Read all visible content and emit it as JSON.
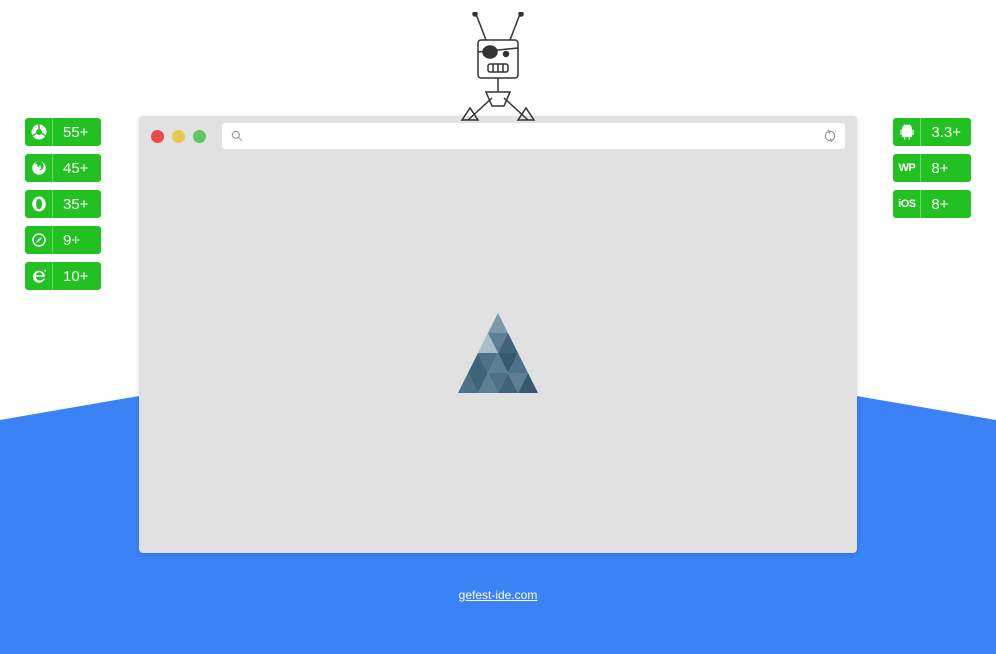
{
  "left_badges": [
    {
      "icon": "chrome",
      "label": "55+"
    },
    {
      "icon": "firefox",
      "label": "45+"
    },
    {
      "icon": "opera",
      "label": "35+"
    },
    {
      "icon": "safari",
      "label": "9+"
    },
    {
      "icon": "ie",
      "label": "10+"
    }
  ],
  "right_badges": [
    {
      "icon": "android",
      "label": "3.3+"
    },
    {
      "icon_text": "WP",
      "label": "8+"
    },
    {
      "icon_text": "iOS",
      "label": "8+"
    }
  ],
  "urlbar": {
    "value": ""
  },
  "footer": {
    "link": "gefest-ide.com"
  }
}
